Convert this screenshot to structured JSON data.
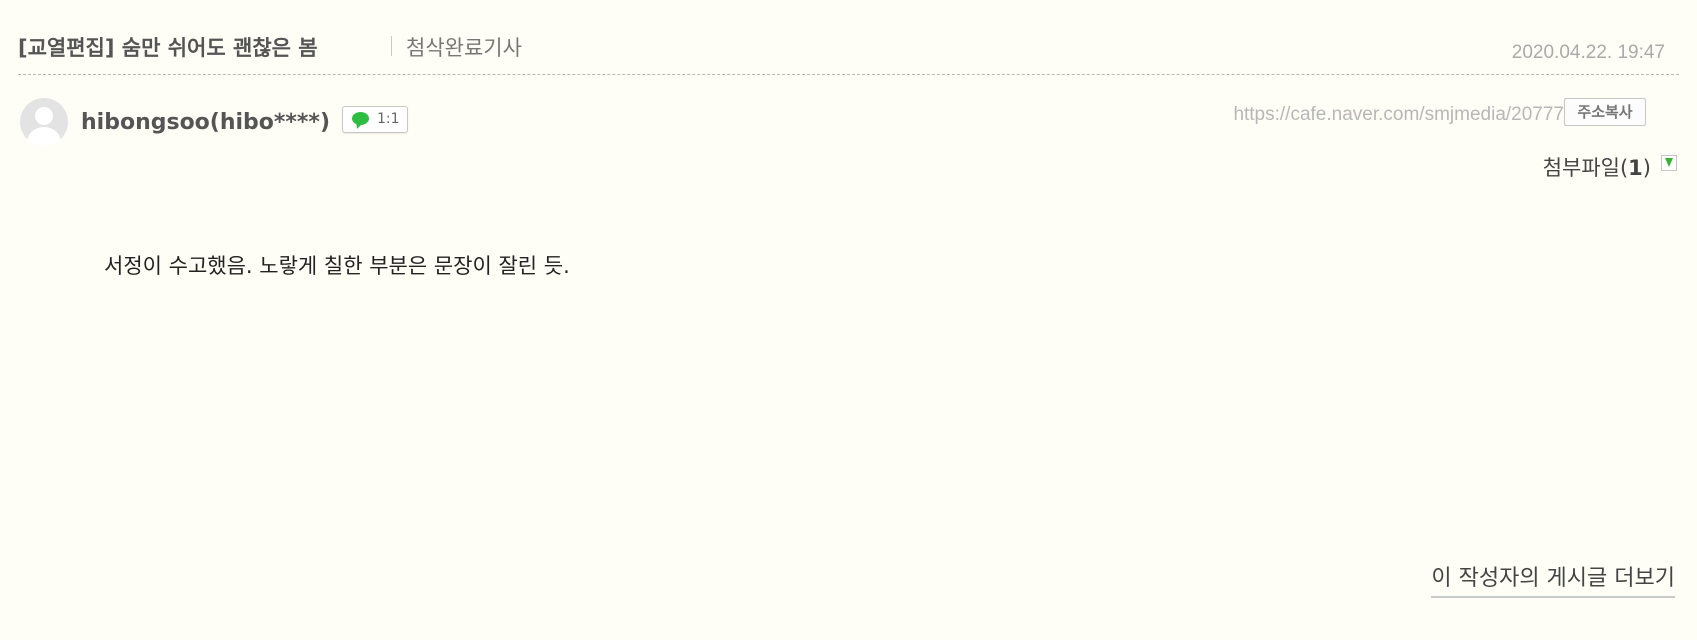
{
  "header": {
    "title": "[교열편집] 숨만 쉬어도 괜찮은 봄",
    "category": "첨삭완료기사",
    "date": "2020.04.22. 19:47"
  },
  "author": {
    "nickname": "hibongsoo(hibo****)",
    "chat_label": "1:1"
  },
  "article_url": "https://cafe.naver.com/smjmedia/20777",
  "copy_button_label": "주소복사",
  "attachments": {
    "label": "첨부파일",
    "count_open": "(",
    "count": "1",
    "count_close": ")"
  },
  "body_text": "서정이 수고했음. 노랗게 칠한 부분은 문장이 잘린 듯.",
  "more_link_label": "이 작성자의 게시글 더보기",
  "icons": {
    "avatar": "default-avatar-icon",
    "chat": "chat-bubble-icon",
    "attachment_toggle": "download-arrow-icon"
  },
  "colors": {
    "background": "#fffef6",
    "chat_green": "#2dbd41",
    "download_green": "#33b533"
  }
}
